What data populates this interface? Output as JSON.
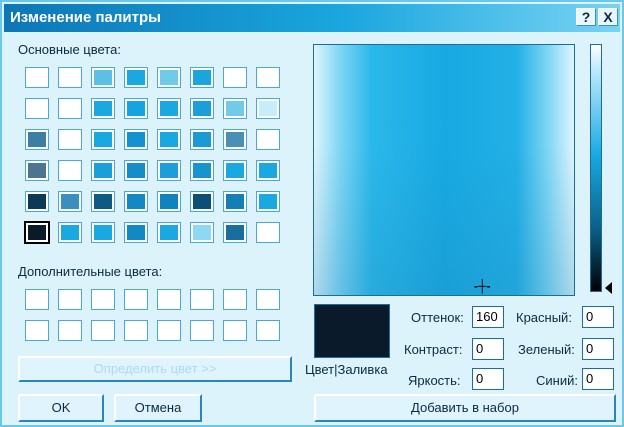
{
  "window": {
    "title": "Изменение палитры",
    "help_label": "?",
    "close_label": "X"
  },
  "basic_colors": {
    "label": "Основные цвета:",
    "swatches": [
      [
        "#ffffff",
        "#ffffff",
        "#5cbfe4",
        "#1aa8e0",
        "#6fcbe9",
        "#1ba5dd",
        "#ffffff",
        "#ffffff"
      ],
      [
        "#ffffff",
        "#ffffff",
        "#1aa8e0",
        "#14a4df",
        "#1aa8e0",
        "#1b9fd8",
        "#6fcbe9",
        "#c8ecfa"
      ],
      [
        "#3b7fa6",
        "#ffffff",
        "#1aa8e0",
        "#1392cf",
        "#1aa8e0",
        "#1a9bd4",
        "#4a8fb5",
        "#ffffff"
      ],
      [
        "#4d7592",
        "#ffffff",
        "#1c9fd8",
        "#158dc7",
        "#1c9fd8",
        "#1793cd",
        "#1aa8e0",
        "#1aa8e0"
      ],
      [
        "#0c3a55",
        "#3a8fbe",
        "#0f5a82",
        "#1389c3",
        "#1082bd",
        "#0b4f75",
        "#157fb5",
        "#1aa8e0"
      ],
      [
        "#0a1a2a",
        "#1aa8e0",
        "#1aa8e0",
        "#1389c3",
        "#1aa8e0",
        "#8fd8f4",
        "#1a6e9c",
        "#ffffff"
      ]
    ]
  },
  "custom_colors": {
    "label": "Дополнительные цвета:",
    "swatches": [
      [
        "#ffffff",
        "#ffffff",
        "#ffffff",
        "#ffffff",
        "#ffffff",
        "#ffffff",
        "#ffffff",
        "#ffffff"
      ],
      [
        "#ffffff",
        "#ffffff",
        "#ffffff",
        "#ffffff",
        "#ffffff",
        "#ffffff",
        "#ffffff",
        "#ffffff"
      ]
    ]
  },
  "buttons": {
    "define_custom": "Определить цвет >>",
    "ok": "OK",
    "cancel": "Отмена",
    "add_to_custom": "Добавить в набор"
  },
  "preview": {
    "label": "Цвет|Заливка",
    "color": "#0a1a2a"
  },
  "fields": {
    "hue": {
      "label": "Оттенок:",
      "value": "160"
    },
    "sat": {
      "label": "Контраст:",
      "value": "0"
    },
    "lum": {
      "label": "Яркость:",
      "value": "0"
    },
    "red": {
      "label": "Красный:",
      "value": "0"
    },
    "green": {
      "label": "Зеленый:",
      "value": "0"
    },
    "blue": {
      "label": "Синий:",
      "value": "0"
    }
  }
}
